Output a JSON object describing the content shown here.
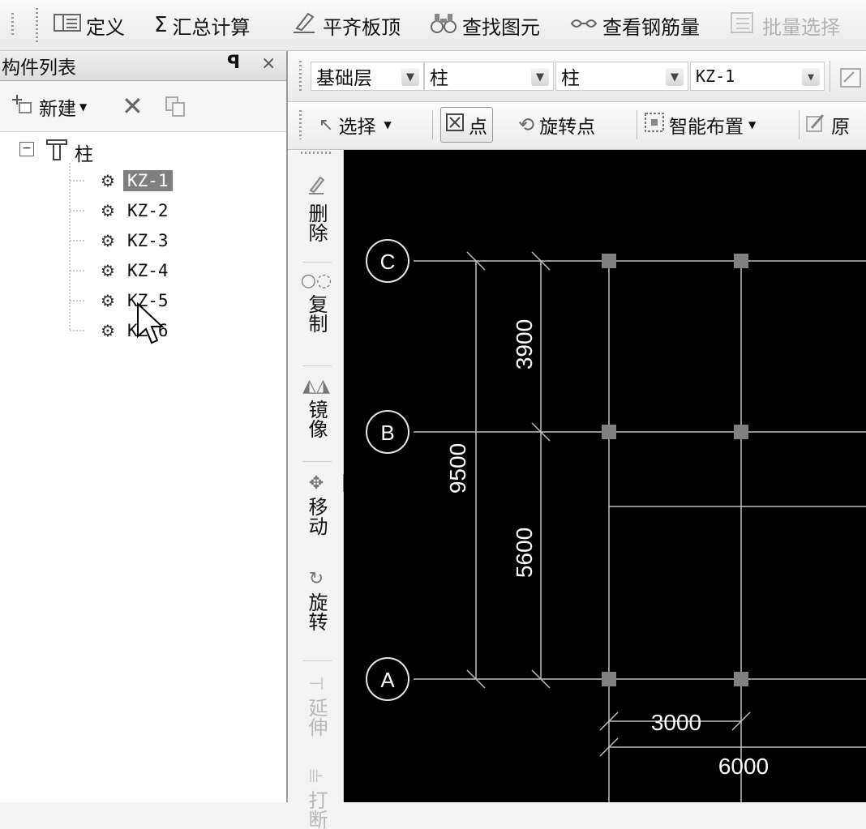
{
  "toolbar": {
    "items": [
      {
        "icon": "define-icon",
        "label": "定义"
      },
      {
        "icon": "sigma-icon",
        "label": "汇总计算"
      },
      {
        "icon": "level-slab-icon",
        "label": "平齐板顶"
      },
      {
        "icon": "binoculars-icon",
        "label": "查找图元"
      },
      {
        "icon": "glasses-icon",
        "label": "查看钢筋量"
      },
      {
        "icon": "batch-select-icon",
        "label": "批量选择",
        "disabled": true
      }
    ]
  },
  "component_panel": {
    "title": "构件列表",
    "pin_icon": "pin-icon",
    "close_icon": "close-icon",
    "new_label": "新建",
    "tree": {
      "root_label": "柱",
      "items": [
        "KZ-1",
        "KZ-2",
        "KZ-3",
        "KZ-4",
        "KZ-5",
        "KZ-6"
      ],
      "selected": "KZ-1"
    }
  },
  "layer_bar": {
    "floor": "基础层",
    "type": "柱",
    "subtype": "柱",
    "component": "KZ-1"
  },
  "edit_bar": {
    "select_label": "选择",
    "point_label": "点",
    "rotate_point_label": "旋转点",
    "smart_layout_label": "智能布置",
    "cut_label": "原"
  },
  "vertical_tools": [
    "删除",
    "复制",
    "镜像",
    "移动",
    "旋转",
    "延伸",
    "打断"
  ],
  "drawing": {
    "axes": [
      "C",
      "B",
      "A"
    ],
    "dimensions": {
      "total_vertical": "9500",
      "upper": "3900",
      "lower": "5600",
      "horizontal_1": "3000",
      "horizontal_2": "6000"
    }
  }
}
